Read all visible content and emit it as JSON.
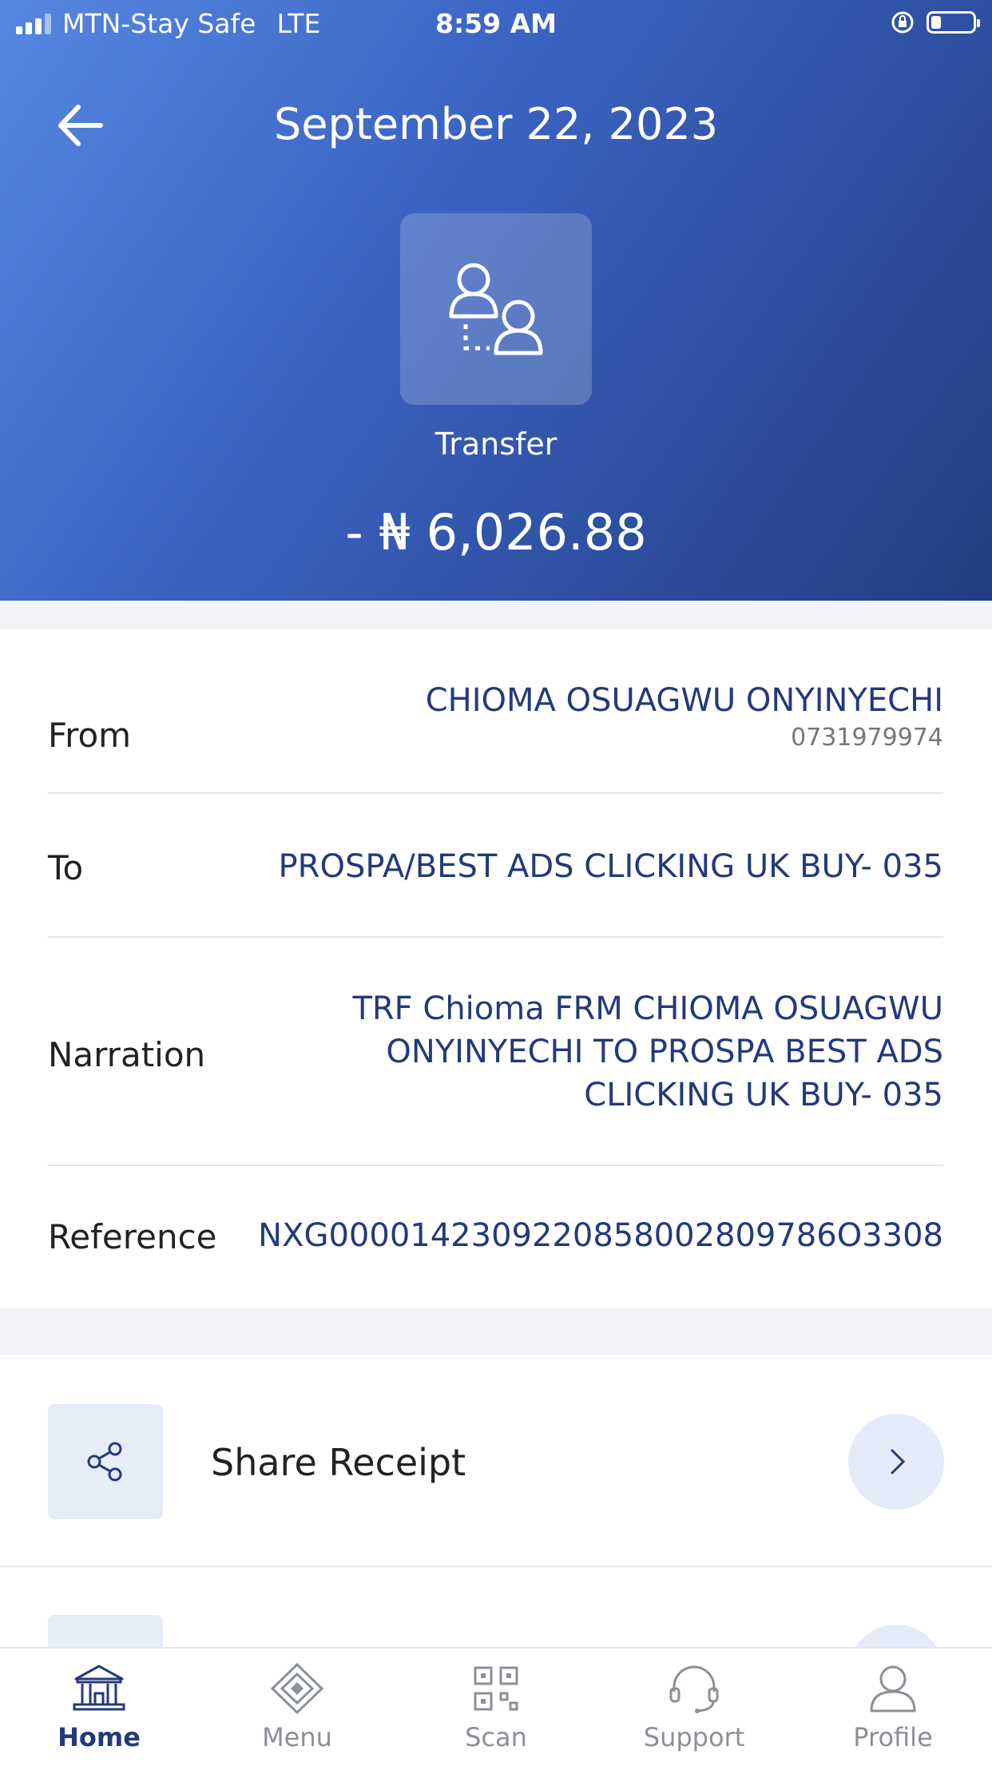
{
  "status_bar": {
    "carrier": "MTN-Stay Safe",
    "network": "LTE",
    "time": "8:59 AM"
  },
  "header": {
    "title": "September 22, 2023",
    "transaction_type": "Transfer",
    "amount": "- ₦ 6,026.88"
  },
  "details": {
    "from": {
      "label": "From",
      "name": "CHIOMA OSUAGWU ONYINYECHI",
      "account": "0731979974"
    },
    "to": {
      "label": "To",
      "value": "PROSPA/BEST ADS CLICKING UK BUY- 035"
    },
    "narration": {
      "label": "Narration",
      "lines": [
        "TRF Chioma FRM CHIOMA OSUAGWU",
        "ONYINYECHI TO PROSPA BEST ADS",
        "CLICKING UK BUY- 035"
      ]
    },
    "reference": {
      "label": "Reference",
      "value": "NXG0000142309220858002809786O3308"
    }
  },
  "actions": {
    "share_receipt": "Share Receipt"
  },
  "tabbar": {
    "items": [
      {
        "label": "Home",
        "icon": "bank-icon",
        "active": true
      },
      {
        "label": "Menu",
        "icon": "diamond-icon",
        "active": false
      },
      {
        "label": "Scan",
        "icon": "qr-code-icon",
        "active": false
      },
      {
        "label": "Support",
        "icon": "headset-icon",
        "active": false
      },
      {
        "label": "Profile",
        "icon": "user-icon",
        "active": false
      }
    ]
  },
  "colors": {
    "header_gradient_start": "#5787e3",
    "header_gradient_end": "#233d80",
    "value_text": "#233a7a",
    "tile_background": "#e6ecf8"
  }
}
